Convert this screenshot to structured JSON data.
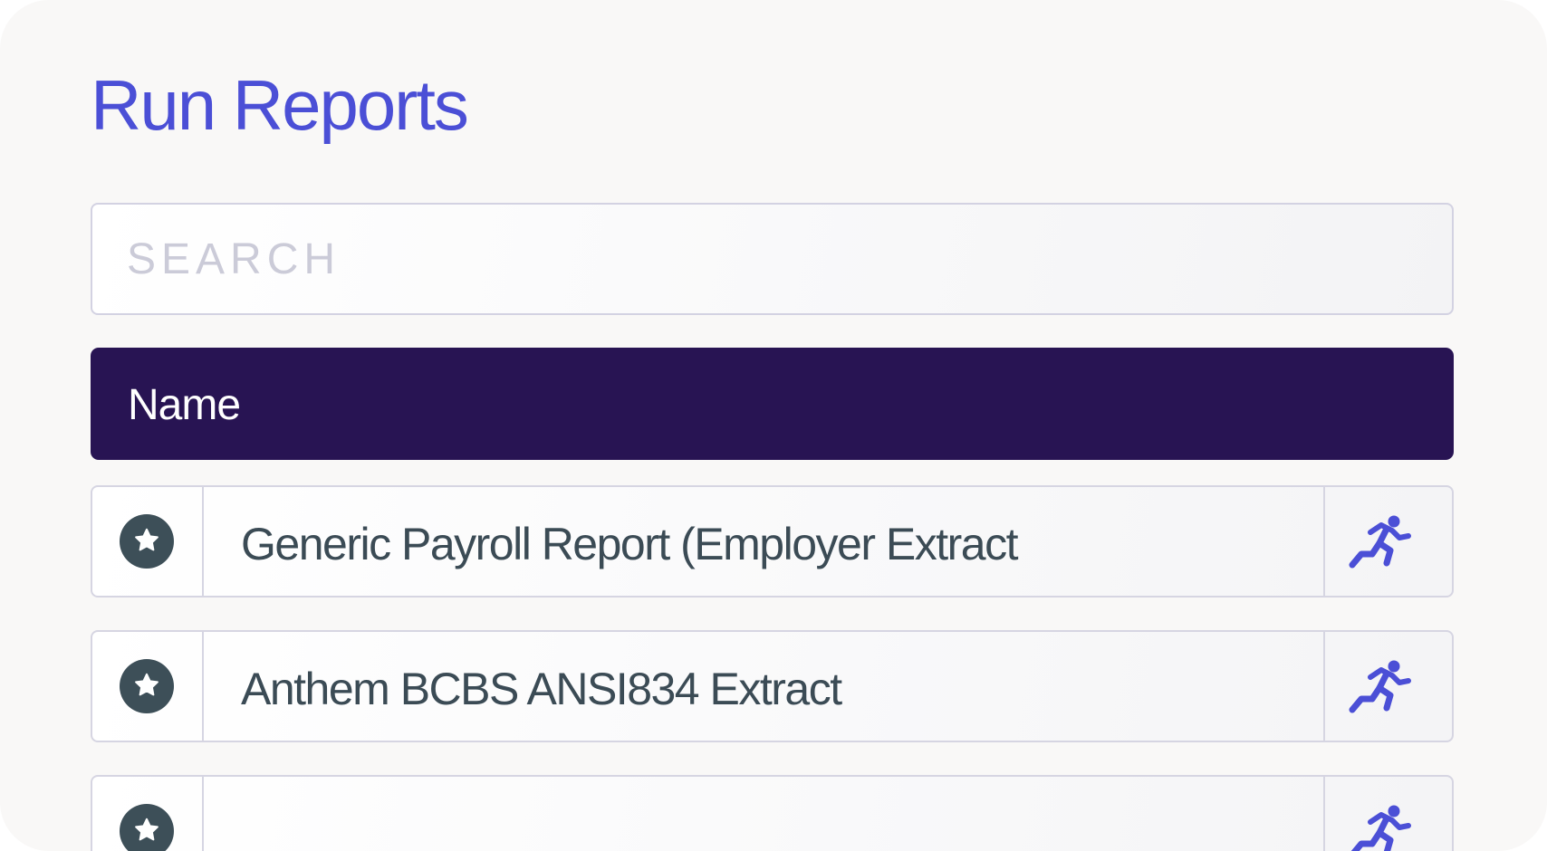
{
  "page": {
    "title": "Run Reports"
  },
  "search": {
    "placeholder": "SEARCH",
    "value": ""
  },
  "table": {
    "header": {
      "name_label": "Name"
    },
    "rows": [
      {
        "name": "Generic Payroll Report (Employer Extract",
        "favorite_icon": "star-icon",
        "action_icon": "running-person-icon"
      },
      {
        "name": "Anthem BCBS ANSI834 Extract",
        "favorite_icon": "star-icon",
        "action_icon": "running-person-icon"
      },
      {
        "name": "",
        "favorite_icon": "star-icon",
        "action_icon": "running-person-icon"
      }
    ]
  },
  "colors": {
    "accent": "#4b4fd6",
    "header_bg": "#281453",
    "text": "#3b4b55",
    "star_badge": "#3d4f58",
    "panel_bg": "#f9f8f7"
  }
}
